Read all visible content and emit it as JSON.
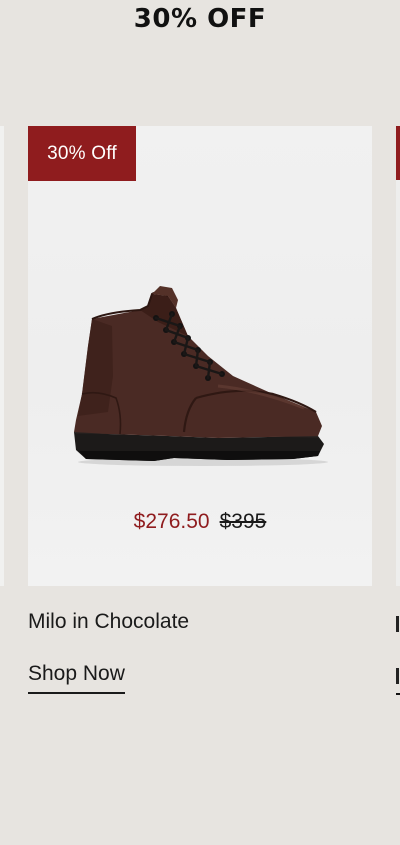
{
  "promo": {
    "headline": "30% OFF"
  },
  "product": {
    "badge": "30% Off",
    "sale_price": "$276.50",
    "original_price": "$395",
    "name": "Milo in Chocolate",
    "cta": "Shop Now",
    "image_alt": "brown leather lace-up boot"
  },
  "colors": {
    "background": "#e7e4e0",
    "accent": "#8f1c1e",
    "text": "#1a1a1a"
  }
}
